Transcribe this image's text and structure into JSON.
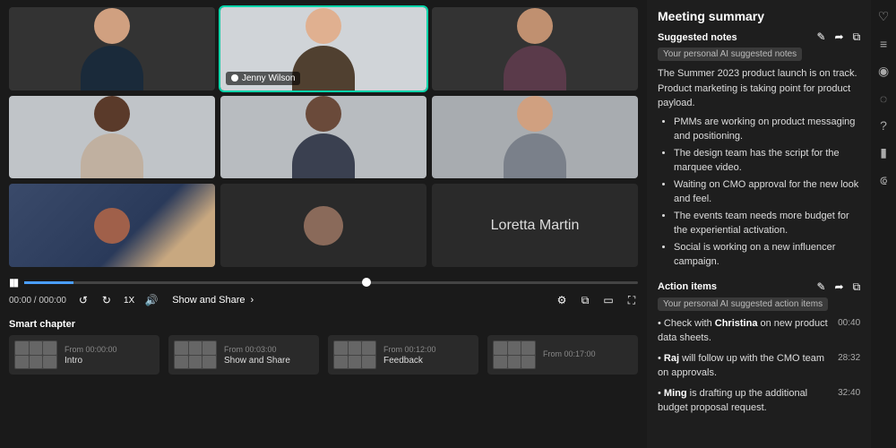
{
  "participants": {
    "active_name": "Jenny Wilson",
    "text_tile": "Loretta Martin"
  },
  "player": {
    "time": "00:00 / 000:00",
    "speed": "1X",
    "segment_label": "Show and Share"
  },
  "chapters": {
    "title": "Smart chapter",
    "items": [
      {
        "from": "From 00:00:00",
        "name": "Intro"
      },
      {
        "from": "From 00:03:00",
        "name": "Show and Share"
      },
      {
        "from": "From 00:12:00",
        "name": "Feedback"
      },
      {
        "from": "From 00:17:00",
        "name": ""
      }
    ]
  },
  "summary": {
    "title": "Meeting summary",
    "notes": {
      "heading": "Suggested notes",
      "badge": "Your personal AI suggested notes",
      "paragraph": "The Summer 2023 product launch is on track. Product marketing is taking point for product payload.",
      "bullets": [
        "PMMs are working on product messaging and positioning.",
        "The design team has the script for the marquee video.",
        "Waiting on CMO approval for the new look and feel.",
        "The events team needs more budget for the experiential activation.",
        "Social is working on a new influencer campaign."
      ]
    },
    "actions": {
      "heading": "Action items",
      "badge": "Your personal AI suggested action items",
      "items": [
        {
          "pre": "Check with ",
          "bold": "Christina",
          "post": " on new product data sheets.",
          "time": "00:40"
        },
        {
          "pre": "",
          "bold": "Raj",
          "post": " will follow up with the CMO team on approvals.",
          "time": "28:32"
        },
        {
          "pre": "",
          "bold": "Ming",
          "post": " is drafting up the additional budget proposal request.",
          "time": "32:40"
        }
      ]
    }
  }
}
